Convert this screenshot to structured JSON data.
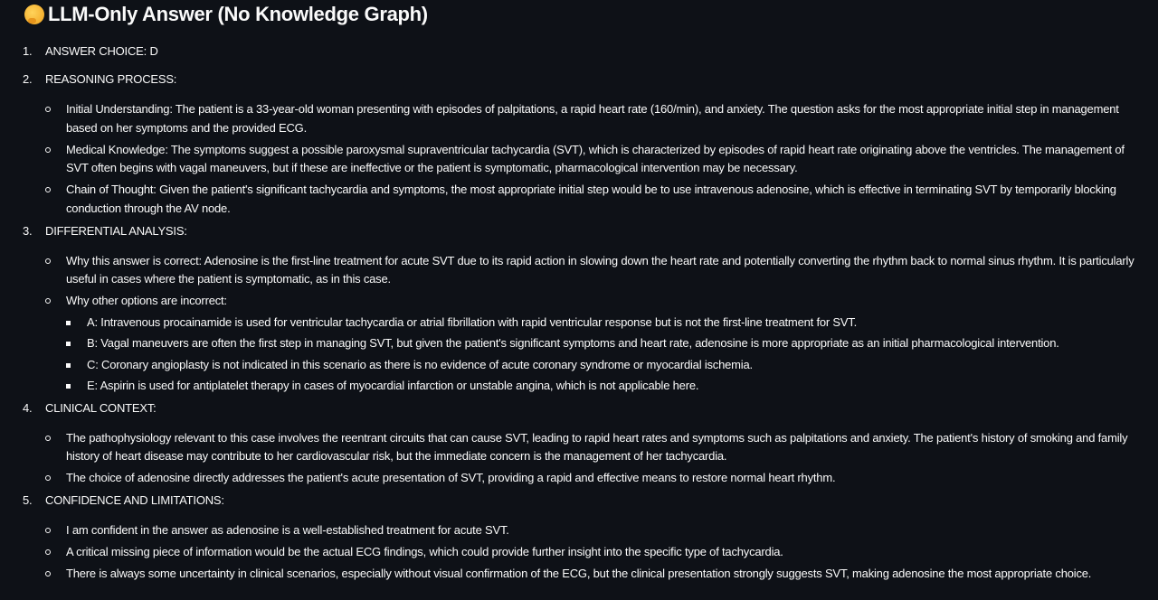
{
  "title": "LLM-Only Answer (No Knowledge Graph)",
  "title_icon": "thinking-face-emoji",
  "sections": [
    {
      "num": "1.",
      "label": "ANSWER CHOICE: D",
      "items": []
    },
    {
      "num": "2.",
      "label": "REASONING PROCESS:",
      "items": [
        {
          "text": "Initial Understanding: The patient is a 33-year-old woman presenting with episodes of palpitations, a rapid heart rate (160/min), and anxiety. The question asks for the most appropriate initial step in management based on her symptoms and the provided ECG."
        },
        {
          "text": "Medical Knowledge: The symptoms suggest a possible paroxysmal supraventricular tachycardia (SVT), which is characterized by episodes of rapid heart rate originating above the ventricles. The management of SVT often begins with vagal maneuvers, but if these are ineffective or the patient is symptomatic, pharmacological intervention may be necessary."
        },
        {
          "text": "Chain of Thought: Given the patient's significant tachycardia and symptoms, the most appropriate initial step would be to use intravenous adenosine, which is effective in terminating SVT by temporarily blocking conduction through the AV node."
        }
      ]
    },
    {
      "num": "3.",
      "label": "DIFFERENTIAL ANALYSIS:",
      "items": [
        {
          "text": "Why this answer is correct: Adenosine is the first-line treatment for acute SVT due to its rapid action in slowing down the heart rate and potentially converting the rhythm back to normal sinus rhythm. It is particularly useful in cases where the patient is symptomatic, as in this case."
        },
        {
          "text": "Why other options are incorrect:",
          "children": [
            "A: Intravenous procainamide is used for ventricular tachycardia or atrial fibrillation with rapid ventricular response but is not the first-line treatment for SVT.",
            "B: Vagal maneuvers are often the first step in managing SVT, but given the patient's significant symptoms and heart rate, adenosine is more appropriate as an initial pharmacological intervention.",
            "C: Coronary angioplasty is not indicated in this scenario as there is no evidence of acute coronary syndrome or myocardial ischemia.",
            "E: Aspirin is used for antiplatelet therapy in cases of myocardial infarction or unstable angina, which is not applicable here."
          ]
        }
      ]
    },
    {
      "num": "4.",
      "label": "CLINICAL CONTEXT:",
      "items": [
        {
          "text": "The pathophysiology relevant to this case involves the reentrant circuits that can cause SVT, leading to rapid heart rates and symptoms such as palpitations and anxiety. The patient's history of smoking and family history of heart disease may contribute to her cardiovascular risk, but the immediate concern is the management of her tachycardia."
        },
        {
          "text": "The choice of adenosine directly addresses the patient's acute presentation of SVT, providing a rapid and effective means to restore normal heart rhythm."
        }
      ]
    },
    {
      "num": "5.",
      "label": "CONFIDENCE AND LIMITATIONS:",
      "items": [
        {
          "text": "I am confident in the answer as adenosine is a well-established treatment for acute SVT."
        },
        {
          "text": "A critical missing piece of information would be the actual ECG findings, which could provide further insight into the specific type of tachycardia."
        },
        {
          "text": "There is always some uncertainty in clinical scenarios, especially without visual confirmation of the ECG, but the clinical presentation strongly suggests SVT, making adenosine the most appropriate choice."
        }
      ]
    }
  ]
}
